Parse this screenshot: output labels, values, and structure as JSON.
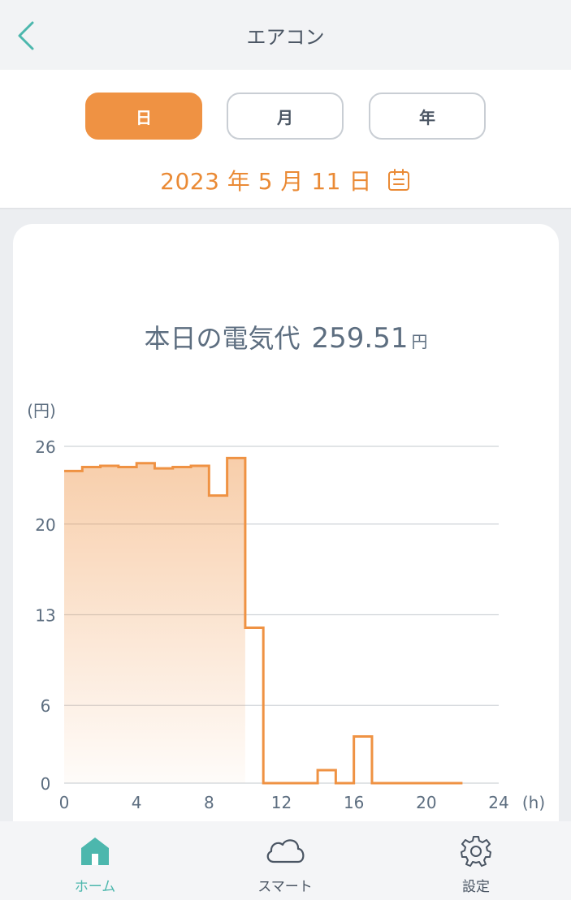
{
  "header": {
    "title": "エアコン",
    "back_icon": "chevron-left-icon"
  },
  "period_tabs": [
    {
      "label": "日",
      "active": true
    },
    {
      "label": "月",
      "active": false
    },
    {
      "label": "年",
      "active": false
    }
  ],
  "date": {
    "text": "2023 年 5 月 11 日",
    "icon": "calendar-icon"
  },
  "summary": {
    "label": "本日の電気代",
    "value": "259.51",
    "unit": "円"
  },
  "chart_data": {
    "type": "area",
    "step": true,
    "ylabel": "(円)",
    "xlabel": "(h)",
    "xlim": [
      0,
      24
    ],
    "ylim": [
      0,
      26
    ],
    "x_ticks": [
      "0",
      "4",
      "8",
      "12",
      "16",
      "20",
      "24"
    ],
    "y_ticks": [
      "26",
      "20",
      "13",
      "6",
      "0"
    ],
    "grid": true,
    "series": [
      {
        "x": [
          0,
          1,
          2,
          3,
          4,
          5,
          6,
          7,
          8,
          9,
          10,
          11,
          12,
          13,
          14,
          15,
          16,
          17,
          18,
          19,
          20,
          21
        ],
        "values": [
          24.1,
          24.4,
          24.5,
          24.4,
          24.7,
          24.3,
          24.4,
          24.5,
          22.2,
          25.1,
          12.0,
          0,
          0,
          0,
          1.0,
          0,
          3.6,
          0,
          0,
          0,
          0,
          0
        ],
        "end_x": 22,
        "fill_from": 0,
        "fill_to": 10
      }
    ]
  },
  "colors": {
    "accent": "#ef9243",
    "primary_teal": "#4cb7ad",
    "text": "#5d6e80"
  },
  "tabbar": [
    {
      "label": "ホーム",
      "icon": "home-icon",
      "active": true
    },
    {
      "label": "スマート",
      "icon": "cloud-icon",
      "active": false
    },
    {
      "label": "設定",
      "icon": "gear-icon",
      "active": false
    }
  ]
}
